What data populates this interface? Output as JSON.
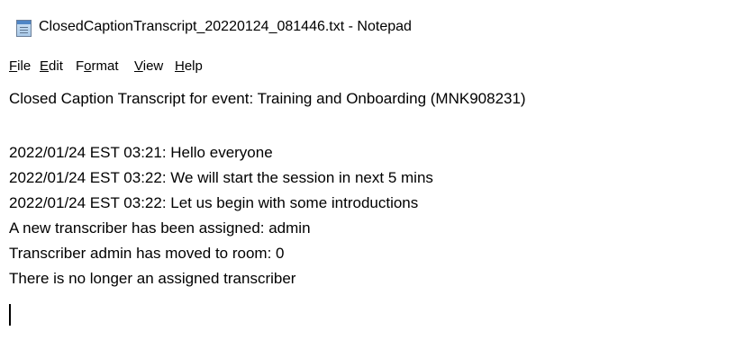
{
  "window": {
    "title": "ClosedCaptionTranscript_20220124_081446.txt - Notepad",
    "icon": "notepad-icon"
  },
  "menu": {
    "file": {
      "accel": "F",
      "rest": "ile"
    },
    "edit": {
      "accel": "E",
      "rest": "dit"
    },
    "format": {
      "pre": "F",
      "accel": "o",
      "rest": "rmat"
    },
    "view": {
      "accel": "V",
      "rest": "iew"
    },
    "help": {
      "accel": "H",
      "rest": "elp"
    }
  },
  "document": {
    "lines": [
      "Closed Caption Transcript for event: Training and Onboarding (MNK908231)",
      "",
      "2022/01/24 EST 03:21: Hello everyone",
      "2022/01/24 EST 03:22: We will start the session in next 5 mins",
      "2022/01/24 EST 03:22: Let us begin with some introductions",
      "A new transcriber has been assigned: admin",
      "Transcriber admin has moved to room: 0",
      "There is no longer an assigned transcriber"
    ]
  }
}
